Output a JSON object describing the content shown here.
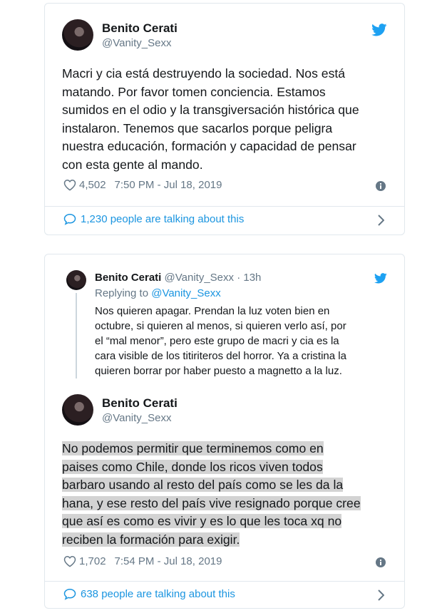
{
  "tweet1": {
    "name": "Benito Cerati",
    "handle": "@Vanity_Sexx",
    "text_lines": [
      "Macri y cia está destruyendo la sociedad. Nos está",
      "matando. Por favor tomen conciencia. Estamos",
      "sumidos en el odio y la transgiversación histórica que",
      "instalaron. Tenemos que sacarlos porque peligra",
      "nuestra educación, formación y capacidad de pensar",
      "con esta gente al mando."
    ],
    "likes": "4,502",
    "timestamp": "7:50 PM - Jul 18, 2019",
    "talking": "1,230 people are talking about this"
  },
  "quoted": {
    "name": "Benito Cerati",
    "handle": "@Vanity_Sexx",
    "sep": "·",
    "age": "13h",
    "replying_prefix": "Replying to ",
    "replying_to": "@Vanity_Sexx",
    "text_lines": [
      "Nos quieren apagar. Prendan la luz voten bien en",
      "octubre, si quieren al menos, si quieren verlo así, por",
      "el “mal menor”, pero este grupo de macri y cia es la",
      "cara visible de los titiriteros del horror. Ya a cristina la",
      "quieren borrar por haber puesto a magnetto a la luz."
    ]
  },
  "tweet2": {
    "name": "Benito Cerati",
    "handle": "@Vanity_Sexx",
    "text_lines": [
      "No podemos permitir que terminemos como en",
      "paises como Chile, donde los ricos viven todos",
      "barbaro usando al resto del país como se les da la",
      "hana, y ese resto del país vive resignado porque cree",
      "que así es como es vivir y es lo que les toca xq no",
      "reciben la formación para exigir."
    ],
    "likes": "1,702",
    "timestamp": "7:54 PM - Jul 18, 2019",
    "talking": "638 people are talking about this"
  },
  "colors": {
    "link": "#1b95e0",
    "muted": "#657786",
    "border": "#e1e8ed",
    "highlight": "#d3d3d3"
  },
  "icons": [
    "twitter-bird-icon",
    "heart-icon",
    "info-icon",
    "speech-bubble-icon",
    "chevron-right-icon"
  ]
}
